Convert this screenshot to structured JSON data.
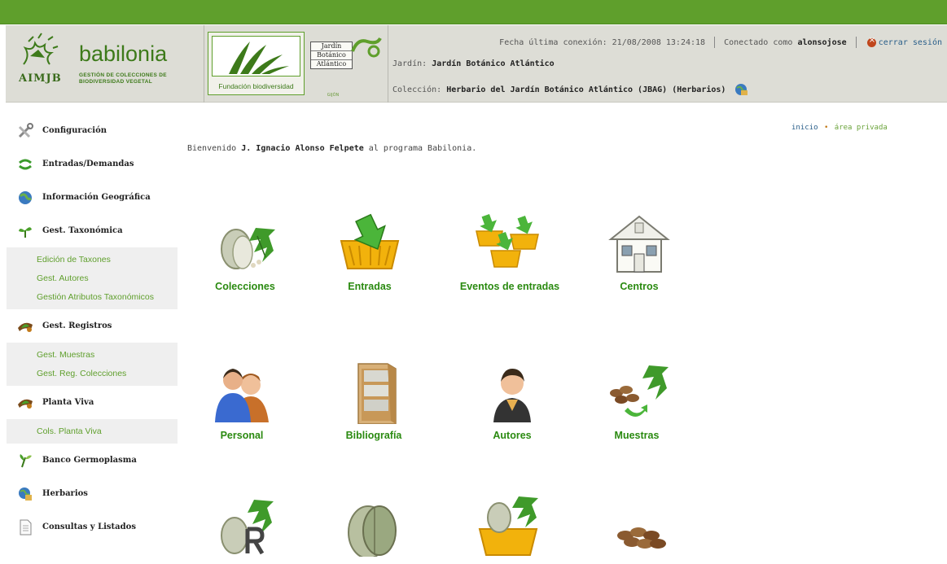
{
  "colors": {
    "brand_green": "#5f9f2c",
    "tile_label": "#2a8a10",
    "link_blue": "#2a5f8a"
  },
  "header": {
    "org": {
      "mark": "AIMJB",
      "title": "babilonia",
      "subtitle": "GESTIÓN DE COLECCIONES DE BIODIVERSIDAD VEGETAL"
    },
    "fundacion_label": "Fundación biodiversidad",
    "jardin_logo": {
      "lines": [
        "Jardín",
        "Botánico",
        "Atlántico"
      ],
      "footer": "GIJÓN"
    },
    "last_connection_label": "Fecha última conexión:",
    "last_connection_value": "21/08/2008 13:24:18",
    "connected_as_label": "Conectado como",
    "user": "alonsojose",
    "logout_label": "cerrar sesión",
    "garden_label": "Jardín:",
    "garden_value": "Jardín Botánico Atlántico",
    "collection_label": "Colección:",
    "collection_value": "Herbario del Jardín Botánico Atlántico (JBAG) (Herbarios)"
  },
  "sidebar": {
    "configuracion": "Configuración",
    "entradas_demandas": "Entradas/Demandas",
    "info_geografica": "Información Geográfica",
    "gest_taxonomica": "Gest. Taxonómica",
    "taxo_sub": [
      "Edición de Taxones",
      "Gest. Autores",
      "Gestión Atributos Taxonómicos"
    ],
    "gest_registros": "Gest. Registros",
    "reg_sub": [
      "Gest. Muestras",
      "Gest. Reg. Colecciones"
    ],
    "planta_viva": "Planta Viva",
    "planta_sub": [
      "Cols. Planta Viva"
    ],
    "banco_germoplasma": "Banco Germoplasma",
    "herbarios": "Herbarios",
    "consultas": "Consultas y Listados"
  },
  "breadcrumb": {
    "home": "inicio",
    "sep": "•",
    "current": "área privada"
  },
  "welcome": {
    "prefix": "Bienvenido",
    "name": "J. Ignacio Alonso Felpete",
    "suffix": "al programa Babilonia."
  },
  "tiles": [
    {
      "label": "Colecciones",
      "icon": "leaves-icon"
    },
    {
      "label": "Entradas",
      "icon": "basket-arrow-icon"
    },
    {
      "label": "Eventos de entradas",
      "icon": "baskets-icon"
    },
    {
      "label": "Centros",
      "icon": "house-icon"
    },
    {
      "label": "Personal",
      "icon": "people-icon"
    },
    {
      "label": "Bibliografía",
      "icon": "bookshelf-icon"
    },
    {
      "label": "Autores",
      "icon": "person-icon"
    },
    {
      "label": "Muestras",
      "icon": "seeds-leaves-icon"
    }
  ]
}
